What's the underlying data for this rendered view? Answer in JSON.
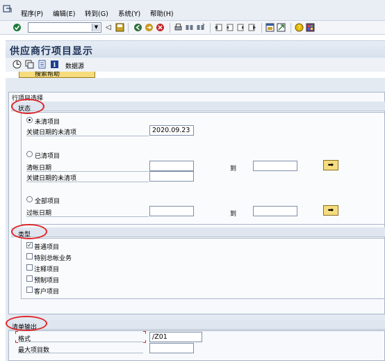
{
  "menubar": {
    "items": [
      "程序(P)",
      "编辑(E)",
      "转到(G)",
      "系统(Y)",
      "帮助(H)"
    ]
  },
  "toolbar": {
    "command_field_value": "",
    "icons": [
      "enter-icon",
      "save-icon",
      "back-icon",
      "exit-icon",
      "cancel-icon",
      "print-icon",
      "find-icon",
      "find-next-icon",
      "first-page-icon",
      "prev-page-icon",
      "next-page-icon",
      "last-page-icon",
      "new-session-icon",
      "shortcut-icon",
      "help-icon",
      "layout-icon"
    ]
  },
  "title": "供应商行项目显示",
  "app_toolbar": {
    "datasource_label": "数据源",
    "multi_select_label": "搜索帮助"
  },
  "line_item_selection": {
    "group_title": "行项目选择",
    "status": {
      "header": "状态",
      "open_items": {
        "radio_label": "未清项目",
        "selected": true,
        "open_at_key_date_label": "关键日期的未清项",
        "open_at_key_date_value": "2020.09.23"
      },
      "cleared_items": {
        "radio_label": "已清项目",
        "selected": false,
        "clearing_date_label": "清帐日期",
        "clearing_date_from": "",
        "to_label": "到",
        "clearing_date_to": "",
        "open_at_key_date_label": "关键日期的未清项",
        "open_at_key_date_value": ""
      },
      "all_items": {
        "radio_label": "全部项目",
        "selected": false,
        "posting_date_label": "过帐日期",
        "posting_date_from": "",
        "to_label": "到",
        "posting_date_to": ""
      }
    },
    "type": {
      "header": "类型",
      "options": [
        {
          "label": "普通项目",
          "checked": true
        },
        {
          "label": "特别总帐业务",
          "checked": false
        },
        {
          "label": "注释项目",
          "checked": false
        },
        {
          "label": "预制项目",
          "checked": false
        },
        {
          "label": "客户项目",
          "checked": false
        }
      ]
    }
  },
  "list_output": {
    "header": "清单输出",
    "layout_label": "格式",
    "layout_value": "/Z01",
    "max_items_label": "最大项目数",
    "max_items_value": ""
  },
  "colors": {
    "annotation_red": "#e0262a",
    "title_text": "#1f3256",
    "button_yellow": "#f6dc7d"
  }
}
